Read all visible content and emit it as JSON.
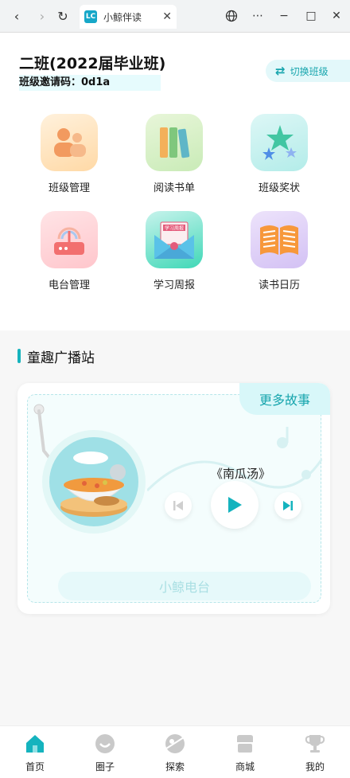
{
  "browser": {
    "tab_title": "小鲸伴读",
    "favicon_text": "LC"
  },
  "header": {
    "class_name": "二班(2022届毕业班)",
    "invite_code": "班级邀请码：0d1a",
    "switch_label": "切换班级"
  },
  "menu": [
    {
      "label": "班级管理",
      "icon": "class-manage-icon"
    },
    {
      "label": "阅读书单",
      "icon": "reading-list-icon"
    },
    {
      "label": "班级奖状",
      "icon": "class-award-icon"
    },
    {
      "label": "电台管理",
      "icon": "radio-manage-icon"
    },
    {
      "label": "学习周报",
      "icon": "weekly-report-icon"
    },
    {
      "label": "读书日历",
      "icon": "reading-calendar-icon"
    }
  ],
  "broadcast": {
    "section_title": "童趣广播站",
    "more_label": "更多故事",
    "song_title": "《南瓜汤》",
    "radio_label": "小鲸电台",
    "envelope_text": "学习周报"
  },
  "bottom_nav": [
    {
      "label": "首页",
      "icon": "home-icon",
      "active": true
    },
    {
      "label": "圈子",
      "icon": "circle-icon",
      "active": false
    },
    {
      "label": "探索",
      "icon": "explore-icon",
      "active": false
    },
    {
      "label": "商城",
      "icon": "shop-icon",
      "active": false
    },
    {
      "label": "我的",
      "icon": "trophy-icon",
      "active": false
    }
  ],
  "colors": {
    "accent": "#17a5ad",
    "inactive_icon": "#c9c9c9"
  }
}
